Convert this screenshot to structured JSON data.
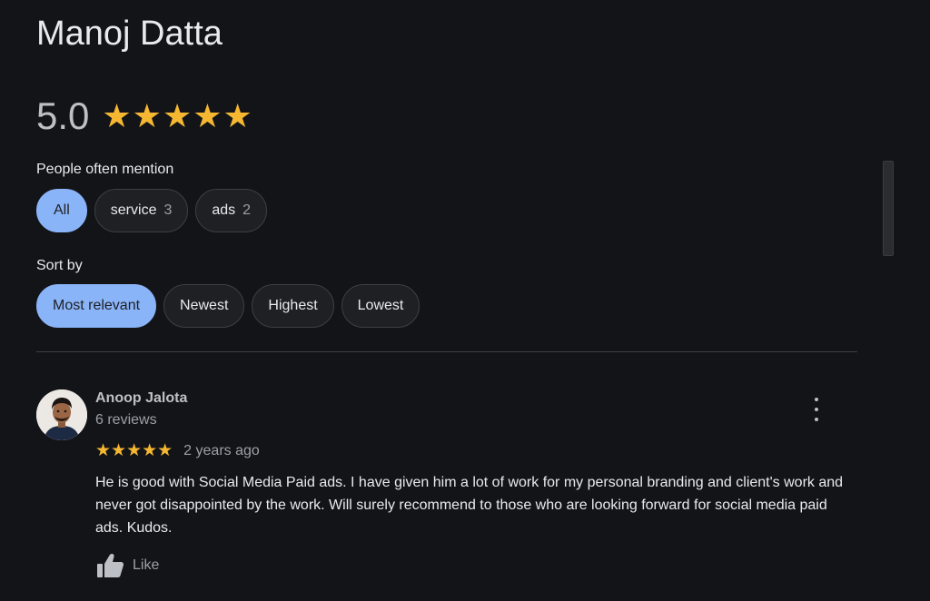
{
  "header": {
    "title": "Manoj Datta",
    "rating": "5.0",
    "rating_stars": "★★★★★",
    "rating_fraction": 1.0
  },
  "mentions": {
    "label": "People often mention",
    "chips": [
      {
        "label": "All",
        "count": ""
      },
      {
        "label": "service",
        "count": "3"
      },
      {
        "label": "ads",
        "count": "2"
      }
    ]
  },
  "sort": {
    "label": "Sort by",
    "options": [
      "Most relevant",
      "Newest",
      "Highest",
      "Lowest"
    ],
    "selected": "Most relevant"
  },
  "review": {
    "author": "Anoop Jalota",
    "author_reviews": "6 reviews",
    "stars": "★★★★★",
    "date": "2 years ago",
    "text": "He is good with Social Media Paid ads. I have given him a lot of work for my personal branding and client's work and never got disappointed by the work. Will surely recommend to those who are looking forward for social media paid ads. Kudos.",
    "like_label": "Like"
  },
  "colors": {
    "background": "#131418",
    "accent": "#8ab4f8",
    "star": "#f5b731"
  },
  "icons": {
    "menu": "more-vert-icon",
    "like": "thumb-up-icon"
  }
}
